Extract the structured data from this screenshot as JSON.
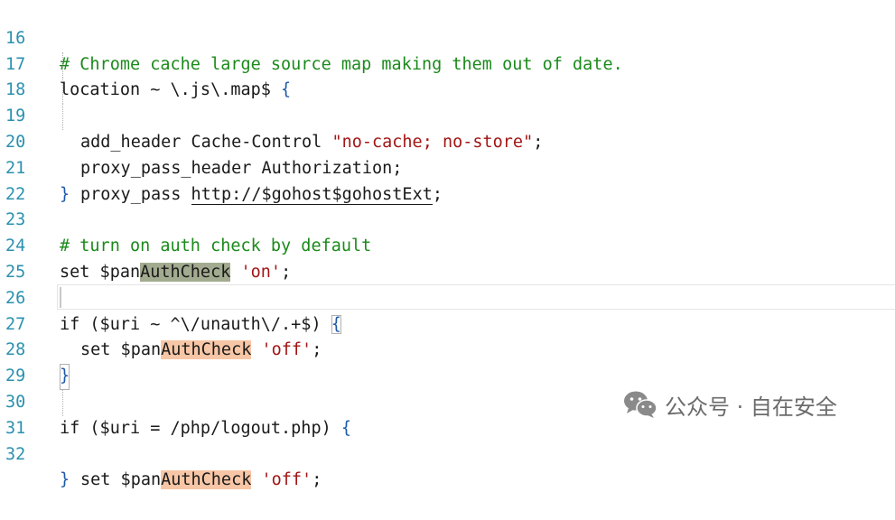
{
  "editor": {
    "lines": [
      {
        "num": "16",
        "comment": "# Chrome cache large source map making them out of date."
      },
      {
        "num": "17",
        "text": "location ~ \\.js\\.map$ ",
        "brace": "{"
      },
      {
        "num": "18",
        "pre": "add_header Cache-Control ",
        "str": "\"no-cache; no-store\"",
        "post": ";"
      },
      {
        "num": "19",
        "text": "proxy_pass_header Authorization;"
      },
      {
        "num": "20",
        "pre": "proxy_pass ",
        "url": "http://$gohost$gohostExt",
        "post": ";"
      },
      {
        "num": "21",
        "brace": "}"
      },
      {
        "num": "22"
      },
      {
        "num": "23",
        "comment": "# turn on auth check by default"
      },
      {
        "num": "24",
        "pre": "set $pan",
        "hl": "AuthCheck",
        "mid": " ",
        "str": "'on'",
        "post": ";"
      },
      {
        "num": "25"
      },
      {
        "num": "26",
        "text": "if ($uri ~ ^\\/unauth\\/.+$) ",
        "brace": "{"
      },
      {
        "num": "27",
        "pre": "set $pan",
        "hl": "AuthCheck",
        "mid": " ",
        "str": "'off'",
        "post": ";"
      },
      {
        "num": "28",
        "brace": "}"
      },
      {
        "num": "29"
      },
      {
        "num": "30",
        "text": "if ($uri = /php/logout.php) ",
        "brace": "{"
      },
      {
        "num": "31",
        "pre": "set $pan",
        "hl": "AuthCheck",
        "mid": " ",
        "str": "'off'",
        "post": ";"
      },
      {
        "num": "32",
        "brace": "}"
      }
    ]
  },
  "watermark": {
    "icon": "wechat-icon",
    "text": "公众号 · 自在安全"
  },
  "colors": {
    "line_numbers": "#2b91af",
    "comment": "#1b8a1b",
    "string": "#a31515",
    "brace": "#1e5aa8",
    "highlight_primary": "#a2ab8f",
    "highlight_secondary": "#f7c6a6"
  }
}
